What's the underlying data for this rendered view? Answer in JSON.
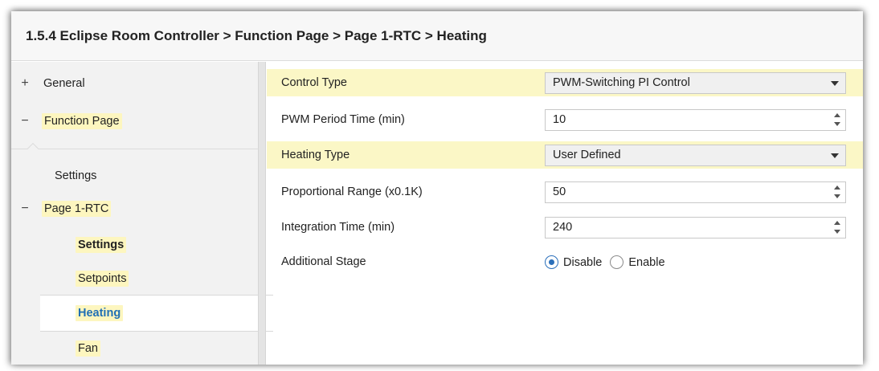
{
  "breadcrumb": "1.5.4 Eclipse Room Controller > Function Page > Page 1-RTC > Heating",
  "sidebar": {
    "general": {
      "toggle": "+",
      "label": "General"
    },
    "function_page": {
      "toggle": "−",
      "label": "Function Page"
    },
    "settings": "Settings",
    "page_rtc": {
      "toggle": "−",
      "label": "Page 1-RTC"
    },
    "rtc_settings": "Settings",
    "setpoints": "Setpoints",
    "heating": "Heating",
    "fan": "Fan"
  },
  "params": {
    "control_type": {
      "label": "Control Type",
      "value": "PWM-Switching PI Control"
    },
    "pwm_period": {
      "label": "PWM Period Time (min)",
      "value": "10"
    },
    "heating_type": {
      "label": "Heating Type",
      "value": "User Defined"
    },
    "proportional_range": {
      "label": "Proportional Range (x0.1K)",
      "value": "50"
    },
    "integration_time": {
      "label": "Integration Time (min)",
      "value": "240"
    },
    "additional_stage": {
      "label": "Additional Stage",
      "options": [
        "Disable",
        "Enable"
      ],
      "selected": "Disable"
    }
  },
  "colors": {
    "highlight": "#fdf6bf",
    "row_highlight": "#fbf7c6",
    "active_text": "#1f6fb5",
    "radio_selected": "#2a6fba"
  }
}
